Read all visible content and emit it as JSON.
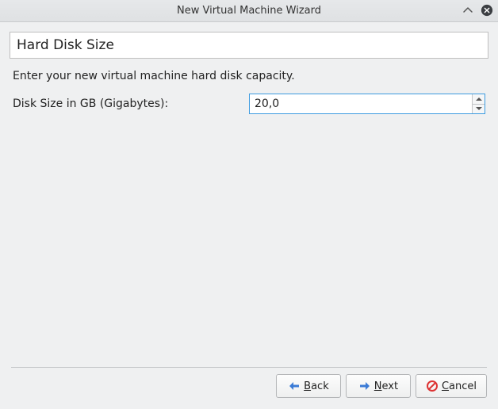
{
  "window": {
    "title": "New Virtual Machine Wizard"
  },
  "header": {
    "title": "Hard Disk Size"
  },
  "instruction": "Enter your new virtual machine hard disk capacity.",
  "form": {
    "disk_size_label": "Disk Size in GB (Gigabytes):",
    "disk_size_value": "20,0"
  },
  "buttons": {
    "back": "Back",
    "next": "Next",
    "cancel": "Cancel"
  }
}
